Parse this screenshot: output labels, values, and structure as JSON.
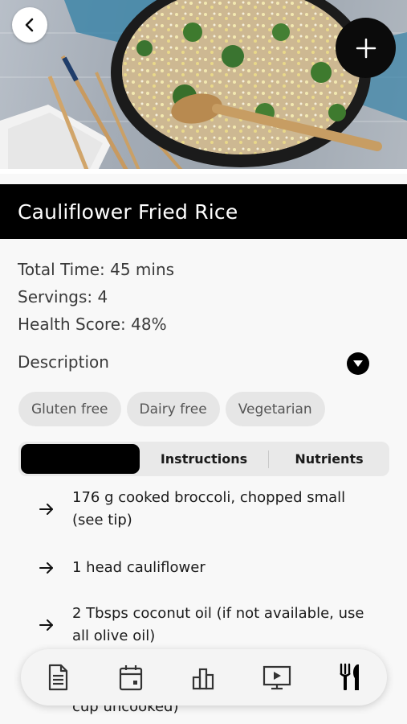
{
  "header": {
    "hero_icon": "recipe-photo",
    "back_icon": "chevron-left-icon",
    "add_icon": "plus-icon"
  },
  "recipe": {
    "title": "Cauliflower Fried Rice",
    "total_time": "Total Time: 45 mins",
    "servings": "Servings: 4",
    "health_score": "Health Score: 48%",
    "description_label": "Description",
    "tags": [
      "Gluten free",
      "Dairy free",
      "Vegetarian"
    ]
  },
  "tabs": {
    "active_label": "",
    "instructions": "Instructions",
    "nutrients": "Nutrients"
  },
  "ingredients": [
    "176 g cooked broccoli, chopped small (see tip)",
    "1 head cauliflower",
    "2 Tbsps coconut oil (if not available, use all olive oil)"
  ],
  "peek_text": "cup uncooked)",
  "bottom_nav": {
    "items": [
      "document-icon",
      "calendar-icon",
      "chart-icon",
      "video-icon",
      "utensils-icon"
    ],
    "active": "utensils-icon"
  },
  "colors": {
    "title_bar": "#000000",
    "tag_bg": "#e6e6e6",
    "tabs_bg": "#e9e9e9",
    "active_tab": "#000000"
  }
}
